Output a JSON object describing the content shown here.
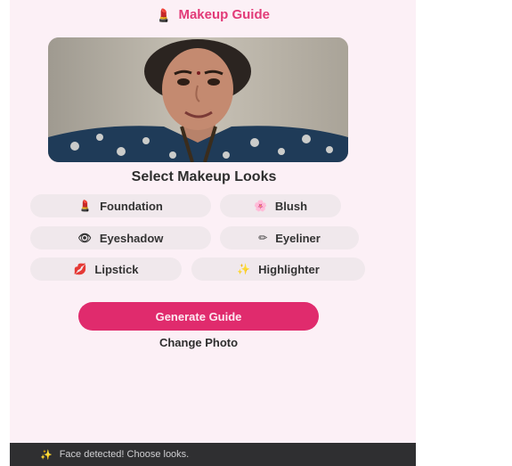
{
  "app": {
    "title": "Makeup Guide",
    "title_icon": "lipstick-icon",
    "accent_color": "#e02b6d",
    "background_color": "#fcf0f6"
  },
  "photo": {
    "alt": "Uploaded face photo"
  },
  "looks": {
    "section_title": "Select Makeup Looks",
    "items": [
      {
        "label": "Foundation",
        "icon": "lipstick-icon",
        "glyph": "💄"
      },
      {
        "label": "Blush",
        "icon": "blossom-icon",
        "glyph": "🌸"
      },
      {
        "label": "Eyeshadow",
        "icon": "eye-icon",
        "glyph": "👁"
      },
      {
        "label": "Eyeliner",
        "icon": "pencil-icon",
        "glyph": "✏"
      },
      {
        "label": "Lipstick",
        "icon": "lips-icon",
        "glyph": "💋"
      },
      {
        "label": "Highlighter",
        "icon": "sparkles-icon",
        "glyph": "✨"
      }
    ]
  },
  "actions": {
    "generate_label": "Generate Guide",
    "change_photo_label": "Change Photo"
  },
  "toast": {
    "icon": "sparkles-icon",
    "glyph": "✨",
    "message": "Face detected! Choose looks."
  }
}
